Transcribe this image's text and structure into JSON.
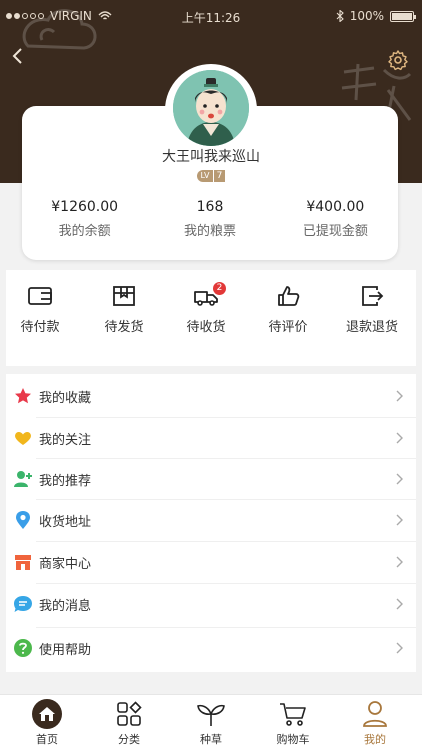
{
  "status_bar": {
    "carrier": "VIRGIN",
    "time": "上午11:26",
    "battery": "100%"
  },
  "profile": {
    "username": "大王叫我来巡山",
    "level_prefix": "LV",
    "level": "7"
  },
  "stats": [
    {
      "value": "¥1260.00",
      "label": "我的余额"
    },
    {
      "value": "168",
      "label": "我的粮票"
    },
    {
      "value": "¥400.00",
      "label": "已提现金额"
    }
  ],
  "orders": [
    {
      "label": "待付款",
      "icon": "wallet-icon"
    },
    {
      "label": "待发货",
      "icon": "package-icon"
    },
    {
      "label": "待收货",
      "icon": "truck-icon",
      "badge": "2"
    },
    {
      "label": "待评价",
      "icon": "thumbs-up-icon"
    },
    {
      "label": "退款退货",
      "icon": "refund-icon"
    }
  ],
  "menu": [
    {
      "label": "我的收藏",
      "icon": "star-icon",
      "color": "#e8394a"
    },
    {
      "label": "我的关注",
      "icon": "heart-icon",
      "color": "#f1b61c"
    },
    {
      "label": "我的推荐",
      "icon": "user-add-icon",
      "color": "#3bb46b"
    },
    {
      "label": "收货地址",
      "icon": "location-icon",
      "color": "#3a9ee8"
    },
    {
      "label": "商家中心",
      "icon": "shop-icon",
      "color": "#f0643c"
    },
    {
      "label": "我的消息",
      "icon": "message-icon",
      "color": "#36a6e6"
    },
    {
      "label": "使用帮助",
      "icon": "help-icon",
      "color": "#4cb84c"
    }
  ],
  "tabs": [
    {
      "label": "首页",
      "icon": "home-icon"
    },
    {
      "label": "分类",
      "icon": "category-icon"
    },
    {
      "label": "种草",
      "icon": "sprout-icon"
    },
    {
      "label": "购物车",
      "icon": "cart-icon"
    },
    {
      "label": "我的",
      "icon": "user-icon",
      "active": true
    }
  ],
  "colors": {
    "header_bg": "#3a2a1e",
    "accent": "#a8773c"
  }
}
